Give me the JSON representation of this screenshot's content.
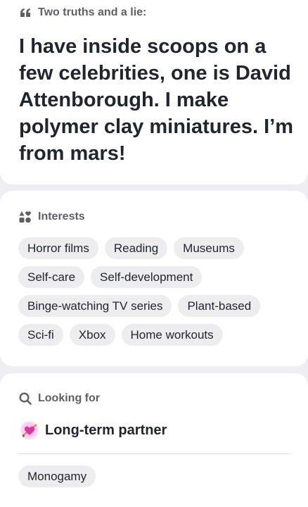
{
  "prompt": {
    "header_icon": "quote-icon",
    "header_label": "Two truths and a lie:",
    "answer": "I have inside scoops on a few celebrities, one is David Attenborough. I make polymer clay miniatures. I’m from mars!"
  },
  "interests": {
    "header_icon": "shapes-icon",
    "header_label": "Interests",
    "items": [
      "Horror films",
      "Reading",
      "Museums",
      "Self-care",
      "Self-development",
      "Binge-watching TV series",
      "Plant-based",
      "Sci-fi",
      "Xbox",
      "Home workouts"
    ]
  },
  "looking_for": {
    "header_icon": "search-icon",
    "header_label": "Looking for",
    "goal_icon": "heart-arrow-icon",
    "goal": "Long-term partner",
    "tags": [
      "Monogamy"
    ]
  },
  "colors": {
    "page_bg": "#efeef2",
    "card_bg": "#ffffff",
    "chip_bg": "#ededf0",
    "text_primary": "#21262e",
    "text_secondary": "#5f5f66"
  }
}
